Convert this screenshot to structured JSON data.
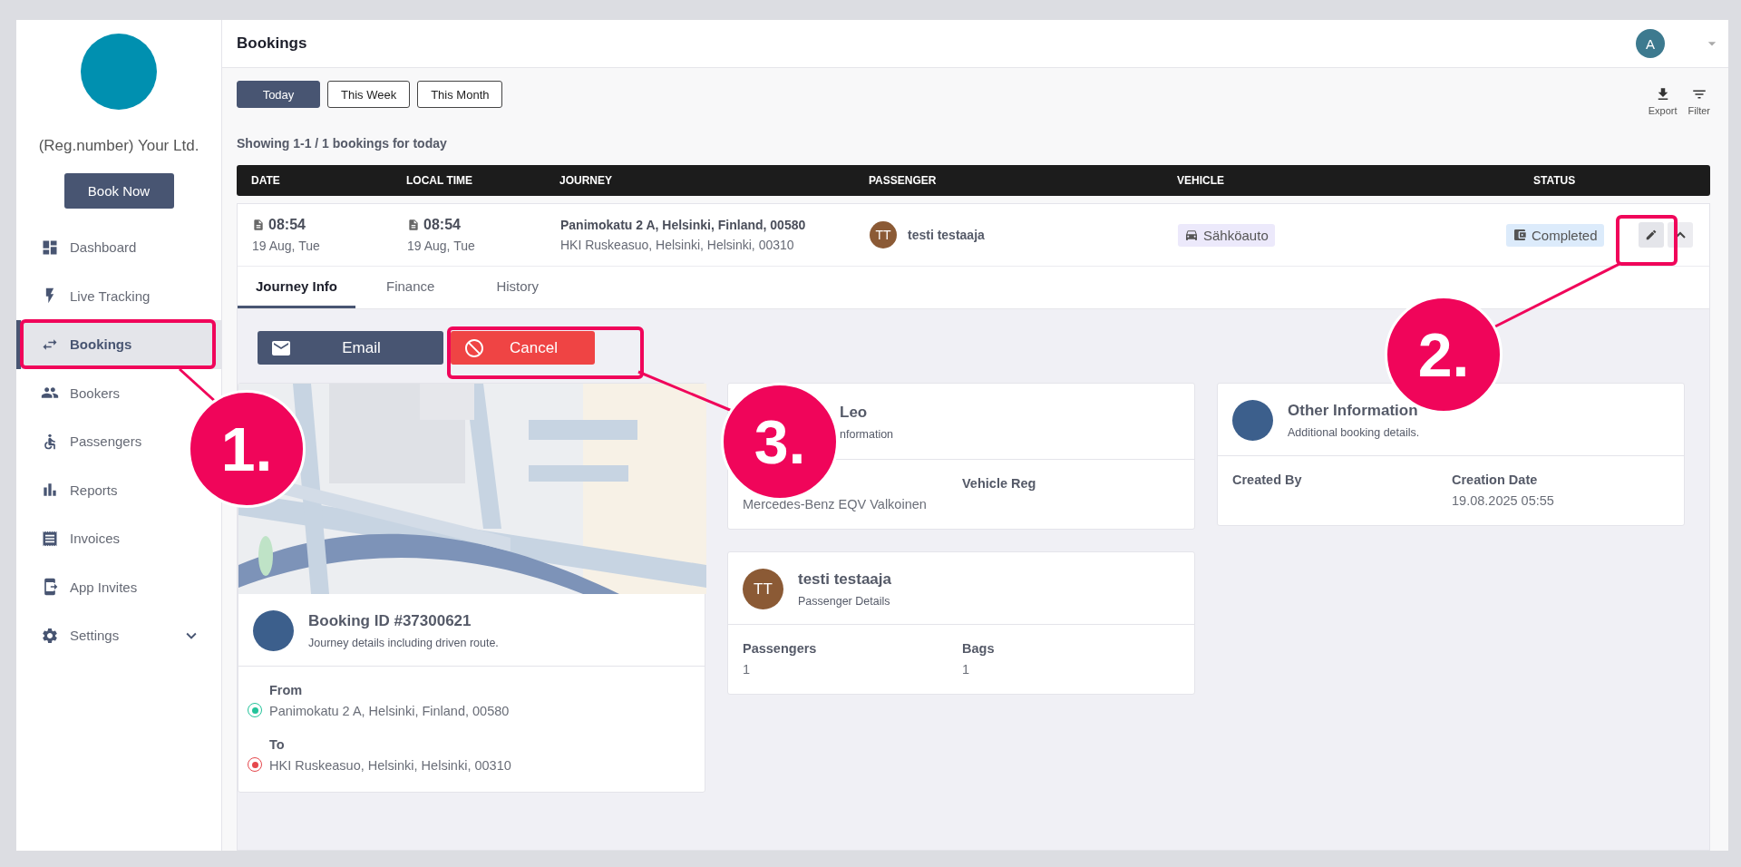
{
  "sidebar": {
    "company": "(Reg.number) Your Ltd.",
    "book_button": "Book Now",
    "items": [
      {
        "label": "Dashboard",
        "selected": false
      },
      {
        "label": "Live Tracking",
        "selected": false
      },
      {
        "label": "Bookings",
        "selected": true
      },
      {
        "label": "Bookers",
        "selected": false
      },
      {
        "label": "Passengers",
        "selected": false
      },
      {
        "label": "Reports",
        "selected": false
      },
      {
        "label": "Invoices",
        "selected": false
      },
      {
        "label": "App Invites",
        "selected": false
      },
      {
        "label": "Settings",
        "selected": false,
        "expanded": false
      }
    ]
  },
  "header": {
    "title": "Bookings",
    "avatar": "A"
  },
  "filters": [
    {
      "label": "Today",
      "selected": true
    },
    {
      "label": "This Week",
      "selected": false
    },
    {
      "label": "This Month",
      "selected": false
    }
  ],
  "tools": [
    {
      "label": "Export",
      "kind": "export"
    },
    {
      "label": "Filter",
      "kind": "filter"
    }
  ],
  "summary": "Showing 1-1 / 1 bookings for today",
  "table": {
    "columns": [
      "DATE",
      "LOCAL TIME",
      "JOURNEY",
      "PASSENGER",
      "VEHICLE",
      "STATUS"
    ],
    "rows": [
      {
        "time": "08:54",
        "date": "19 Aug, Tue",
        "local_time": "08:54",
        "local_date": "19 Aug, Tue",
        "from": "Panimokatu 2 A, Helsinki, Finland, 00580",
        "to": "HKI Ruskeasuo, Helsinki, Helsinki, 00310",
        "passenger_initials": "TT",
        "passenger": "testi testaaja",
        "vehicle": "Sähköauto",
        "status": "Completed",
        "expanded": true
      }
    ]
  },
  "detail_tabs": [
    {
      "label": "Journey Info",
      "selected": true
    },
    {
      "label": "Finance",
      "selected": false
    },
    {
      "label": "History",
      "selected": false
    }
  ],
  "actions": [
    {
      "label": "Email",
      "kind": "email"
    },
    {
      "label": "Cancel",
      "kind": "cancel"
    }
  ],
  "booking_card": {
    "title": "Booking ID #37300621",
    "subtitle": "Journey details including driven route.",
    "stops": [
      {
        "label": "From",
        "address": "Panimokatu 2 A, Helsinki, Finland, 00580",
        "color": "#22c39a"
      },
      {
        "label": "To",
        "address": "HKI Ruskeasuo, Helsinki, Helsinki, 00310",
        "color": "#e5484d"
      }
    ]
  },
  "driver_card": {
    "title": "Leo",
    "subtitle": "nformation",
    "fields": [
      {
        "value": "Mercedes-Benz EQV Valkoinen"
      },
      {
        "label": "Vehicle Reg"
      }
    ]
  },
  "passenger_card": {
    "initials": "TT",
    "title": "testi testaaja",
    "subtitle": "Passenger Details",
    "fields": [
      {
        "label": "Passengers",
        "value": "1"
      },
      {
        "label": "Bags",
        "value": "1"
      }
    ]
  },
  "other_card": {
    "title": "Other Information",
    "subtitle": "Additional booking details.",
    "fields": [
      {
        "label": "Created By"
      },
      {
        "label": "Creation Date",
        "value": "19.08.2025 05:55"
      }
    ]
  },
  "annotations": [
    {
      "label": "1."
    },
    {
      "label": "2."
    },
    {
      "label": "3."
    }
  ]
}
